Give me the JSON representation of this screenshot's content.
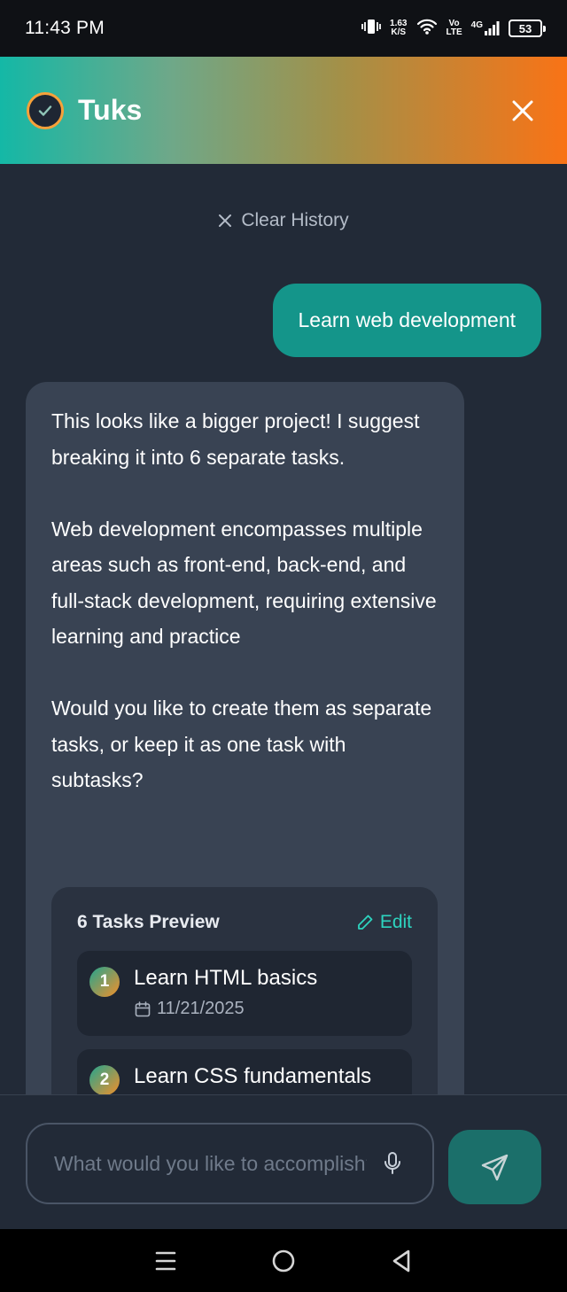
{
  "status_bar": {
    "time": "11:43 PM",
    "net_speed_value": "1.63",
    "net_speed_unit": "K/S",
    "vo": "Vo",
    "lte": "LTE",
    "network": "4G",
    "battery": "53",
    "icons": [
      "vibrate-icon",
      "wifi-icon",
      "signal-icon",
      "battery-icon"
    ]
  },
  "header": {
    "title": "Tuks",
    "logo_icon": "check-logo-icon",
    "close_icon": "close-icon",
    "gradient": [
      "#14b8a6",
      "#f97316"
    ]
  },
  "chat": {
    "clear_history_label": "Clear History",
    "user_message": "Learn web development",
    "bot_message": "This looks like a bigger project! I suggest breaking it into 6 separate tasks.\n\nWeb development encompasses multiple areas such as front-end, back-end, and full-stack development, requiring extensive learning and practice\n\nWould you like to create them as separate tasks, or keep it as one task with subtasks?",
    "preview": {
      "title": "6 Tasks Preview",
      "edit_label": "Edit",
      "tasks": [
        {
          "number": "1",
          "title": "Learn HTML basics",
          "date": "11/21/2025"
        },
        {
          "number": "2",
          "title": "Learn CSS fundamentals",
          "date": ""
        }
      ]
    }
  },
  "composer": {
    "placeholder": "What would you like to accomplish?",
    "mic_icon": "mic-icon",
    "send_icon": "send-icon"
  },
  "colors": {
    "accent": "#14958a",
    "link": "#2dd4bf",
    "background": "#222a37",
    "bubble": "#394353"
  }
}
